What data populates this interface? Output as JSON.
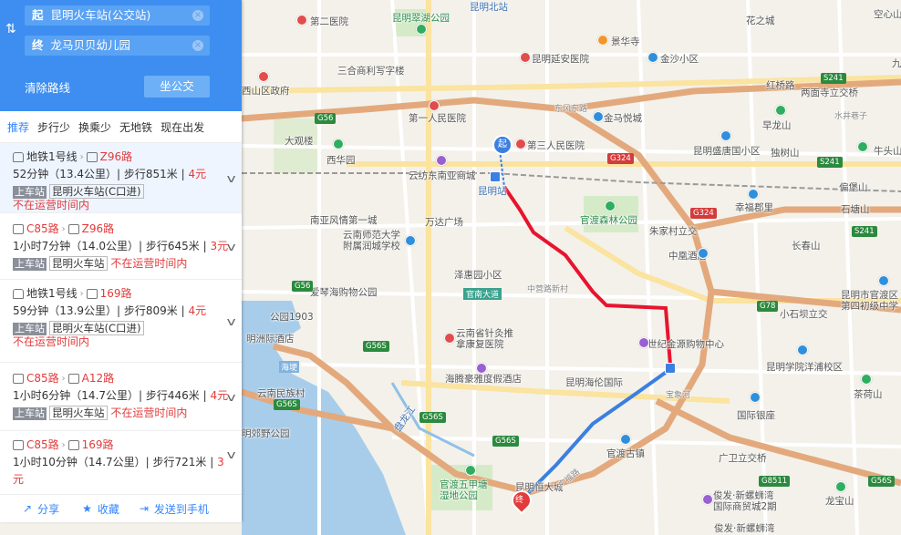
{
  "search": {
    "start_prefix": "起",
    "start_value": "昆明火车站(公交站)",
    "end_prefix": "终",
    "end_value": "龙马贝贝幼儿园",
    "clear_route": "清除路线",
    "take_bus": "坐公交",
    "swap_glyph": "⇅",
    "clear_glyph": "×"
  },
  "tabs": [
    "推荐",
    "步行少",
    "换乘少",
    "无地铁",
    "现在出发"
  ],
  "routes": [
    {
      "seg1": "地铁1号线",
      "seg1_type": "subway",
      "seg2": "Z96路",
      "time": "52分钟",
      "dist": "13.4公里",
      "walk": "步行851米",
      "price": "4元",
      "board_tag": "上车站",
      "station": "昆明火车站(C口进)",
      "status": "不在运营时间内"
    },
    {
      "seg1": "C85路",
      "seg1_type": "bus",
      "seg2": "Z96路",
      "time": "1小时7分钟",
      "dist": "14.0公里",
      "walk": "步行645米",
      "price": "3元",
      "board_tag": "上车站",
      "station": "昆明火车站",
      "status": "不在运营时间内"
    },
    {
      "seg1": "地铁1号线",
      "seg1_type": "subway",
      "seg2": "169路",
      "time": "59分钟",
      "dist": "13.9公里",
      "walk": "步行809米",
      "price": "4元",
      "board_tag": "上车站",
      "station": "昆明火车站(C口进)",
      "status": "不在运营时间内"
    },
    {
      "seg1": "C85路",
      "seg1_type": "bus",
      "seg2": "A12路",
      "time": "1小时6分钟",
      "dist": "14.7公里",
      "walk": "步行446米",
      "price": "4元",
      "board_tag": "上车站",
      "station": "昆明火车站",
      "status": "不在运营时间内"
    },
    {
      "seg1": "C85路",
      "seg1_type": "bus",
      "seg2": "169路",
      "time": "1小时10分钟",
      "dist": "14.7公里",
      "walk": "步行721米",
      "price": "3元",
      "board_tag": "",
      "station": "",
      "status": ""
    }
  ],
  "bottom": {
    "share": "分享",
    "collect": "收藏",
    "send": "发送到手机"
  },
  "map_labels": {
    "l1": "第二医院",
    "l2": "昆明翠湖公园",
    "l3": "昆明北站",
    "l4": "花之城",
    "l5": "空心山",
    "l6": "景华寺",
    "l7": "金沙小区",
    "l8": "三合商利写字楼",
    "l9": "昆明延安医院",
    "l10": "西山区政府",
    "l11": "红桥路",
    "l12": "两面寺立交桥",
    "l13": "水井巷子",
    "l14": "第一人民医院",
    "l15": "金马悦城",
    "l16": "早龙山",
    "l17": "大观楼",
    "l18": "东风东路",
    "l19": "第三人民医院",
    "l20": "昆明盛唐国小区",
    "l21": "独树山",
    "l22": "牛头山",
    "l23": "西华园",
    "l24": "云纺东南亚商城",
    "l25": "昆明站",
    "l26": "偏堡山",
    "l27": "幸福郡里",
    "l28": "石塘山",
    "l29": "南亚风情第一城",
    "l30": "万达广场",
    "l31": "官渡森林公园",
    "l32": "朱家村立交",
    "l33": "云南师范大学附属润城学校",
    "l34": "长春山",
    "l35": "中凰酒店",
    "l36": "昆明市官渡区第四初级中学",
    "l37": "泽惠园小区",
    "l38": "中营路新村",
    "l39": "官南大道",
    "l40": "爱琴海购物公园",
    "l41": "公园1903",
    "l42": "云南省针灸推拿康复医院",
    "l43": "小石坝立交",
    "l44": "明洲际酒店",
    "l45": "世纪金源购物中心",
    "l46": "昆明学院洋浦校区",
    "l47": "海埂",
    "l48": "海腾豪雅度假酒店",
    "l49": "昆明海伦国际",
    "l50": "茶荷山",
    "l51": "云南民族村",
    "l52": "国际银座",
    "l53": "宝象河",
    "l54": "明郊野公园",
    "l55": "官渡古镇",
    "l56": "广卫立交桥",
    "l57": "官渡五甲塘湿地公园",
    "l58": "昆明恒大城",
    "l59": "俊发·新螺蛳湾国际商贸城2期",
    "l60": "龙宝山",
    "l61": "俊发·新螺蛳湾",
    "l62": "九",
    "l63": "盘龙江",
    "l64": "广福路"
  },
  "shields": {
    "s1": "S241",
    "s2": "G56",
    "s3": "G324",
    "s4": "S241",
    "s5": "G324",
    "s6": "G56",
    "s7": "G56S",
    "s8": "G78",
    "s9": "G56S",
    "s10": "G56S",
    "s11": "G56S",
    "s12": "G8511",
    "s13": "G56S",
    "s14": "S241"
  },
  "markers": {
    "start": "起",
    "end": "终"
  },
  "colors": {
    "search_bg": "#3d8ef0",
    "accent": "#3385ff",
    "price_red": "#e23b3b",
    "subway_route": "#e8142e",
    "bus_route": "#3b7fe0",
    "highway": "#e3a97c"
  }
}
